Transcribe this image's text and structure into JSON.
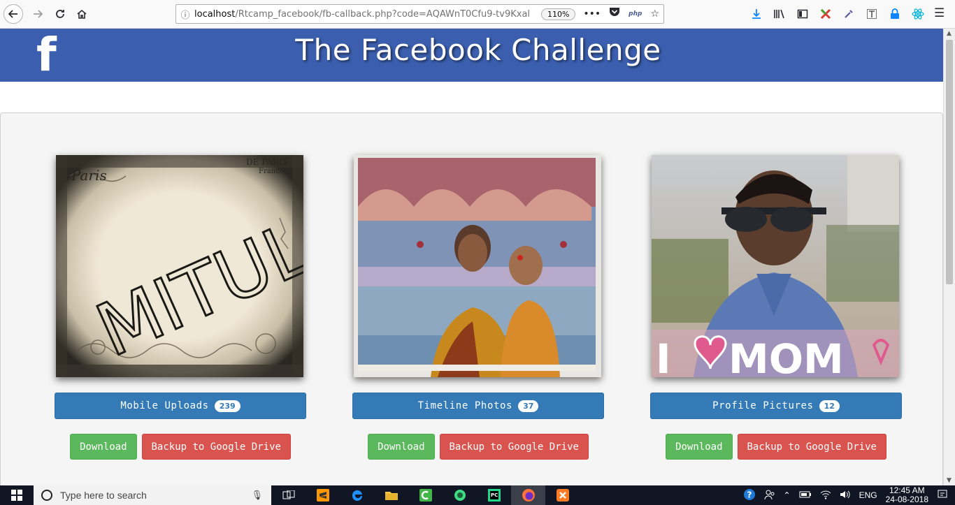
{
  "browser": {
    "url_host": "localhost",
    "url_path": "/Rtcamp_facebook/fb-callback.php?code=AQAWnT0Cfu9-tv9Kxal",
    "zoom": "110%",
    "php_label": "php"
  },
  "site": {
    "logo_letter": "f",
    "title": "The Facebook Challenge"
  },
  "albums": [
    {
      "name": "Mobile Uploads",
      "count": "239",
      "photo_text": "MITUL",
      "photo_corner": "DE PARIS",
      "photo_corner2": "France",
      "download_label": "Download",
      "backup_label": "Backup to Google Drive"
    },
    {
      "name": "Timeline Photos",
      "count": "37",
      "download_label": "Download",
      "backup_label": "Backup to Google Drive"
    },
    {
      "name": "Profile Pictures",
      "count": "12",
      "photo_text_left": "I",
      "photo_text_right": "MOM",
      "download_label": "Download",
      "backup_label": "Backup to Google Drive"
    }
  ],
  "taskbar": {
    "search_placeholder": "Type here to search",
    "language": "ENG",
    "time": "12:45 AM",
    "date": "24-08-2018"
  },
  "colors": {
    "header": "#3b5fae",
    "album_button": "#337ab7",
    "download": "#5cb85c",
    "backup": "#d9534f"
  }
}
